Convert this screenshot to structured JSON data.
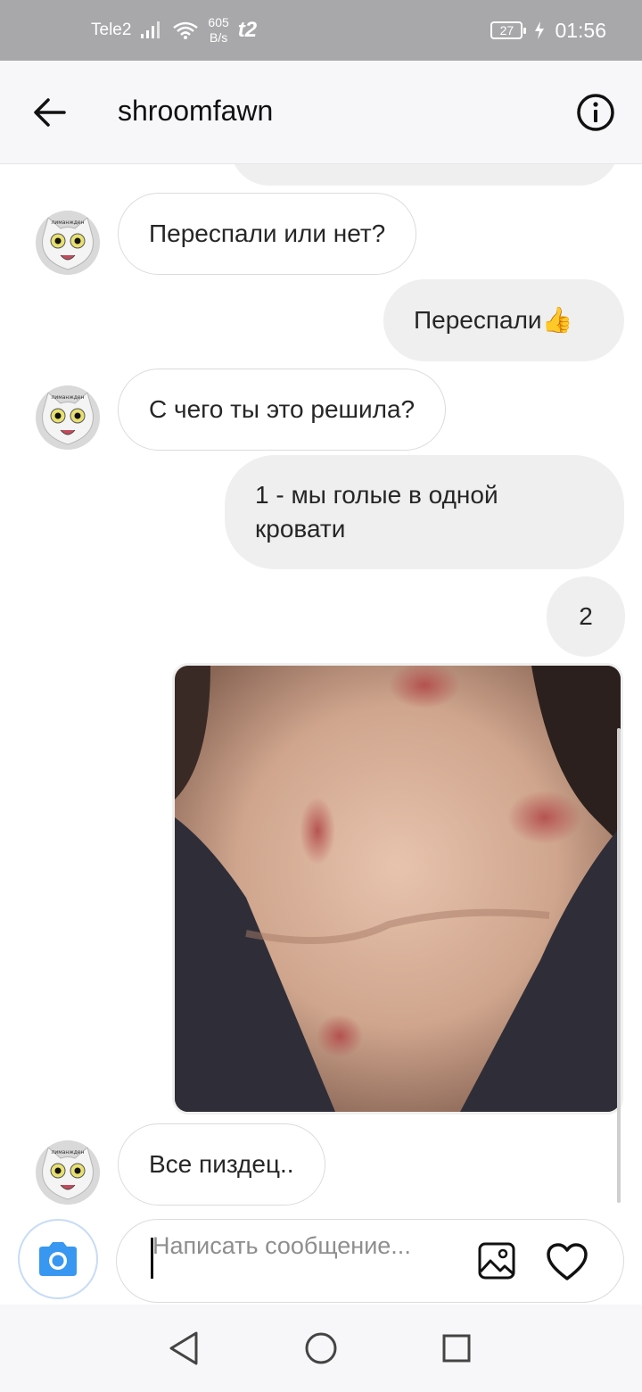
{
  "status_bar": {
    "carrier": "Tele2",
    "speed_value": "605",
    "speed_unit": "B/s",
    "network_badge": "t2",
    "battery": "27",
    "time": "01:56"
  },
  "header": {
    "back_icon": "arrow-left-icon",
    "title": "shroomfawn",
    "info_icon": "info-icon"
  },
  "messages": [
    {
      "sender": "them",
      "type": "text",
      "text": "Переспали или нет?"
    },
    {
      "sender": "me",
      "type": "text",
      "text": "Переспали👍"
    },
    {
      "sender": "them",
      "type": "text",
      "text": "С чего ты это решила?"
    },
    {
      "sender": "me",
      "type": "text",
      "text": "1 - мы голые в одной кровати"
    },
    {
      "sender": "me",
      "type": "text",
      "text": "2"
    },
    {
      "sender": "me",
      "type": "photo"
    },
    {
      "sender": "them",
      "type": "text",
      "text": "Все пиздец.."
    }
  ],
  "avatar_caption": "лиманжден",
  "composer": {
    "camera_icon": "camera-icon",
    "placeholder": "Написать сообщение...",
    "gallery_icon": "image-icon",
    "like_icon": "heart-icon"
  },
  "nav": {
    "back": "triangle-back-icon",
    "home": "circle-home-icon",
    "recents": "square-recents-icon"
  },
  "colors": {
    "status_bar": "#a8a8aa",
    "outgoing_bubble": "#efefef",
    "incoming_border": "#dbdbdb",
    "camera_accent": "#3897f0"
  }
}
